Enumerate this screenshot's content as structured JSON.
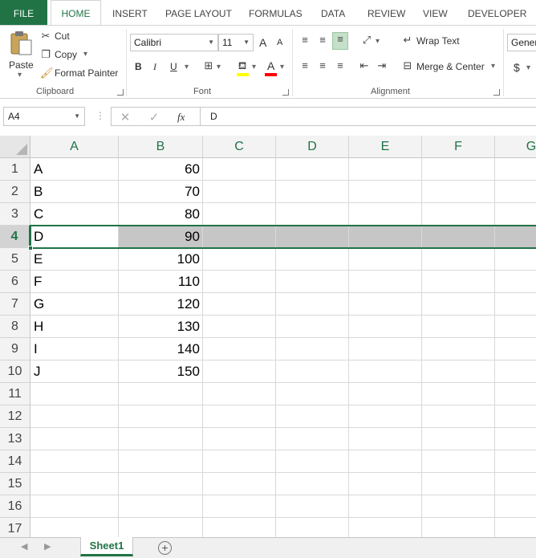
{
  "ribbon_tabs": [
    "FILE",
    "HOME",
    "INSERT",
    "PAGE LAYOUT",
    "FORMULAS",
    "DATA",
    "REVIEW",
    "VIEW",
    "DEVELOPER"
  ],
  "clipboard": {
    "paste": "Paste",
    "cut": "Cut",
    "copy": "Copy",
    "format_painter": "Format Painter",
    "label": "Clipboard"
  },
  "font": {
    "name": "Calibri",
    "size": "11",
    "bold": "B",
    "italic": "I",
    "underline": "U",
    "grow": "A",
    "shrink": "A",
    "color_letter": "A",
    "label": "Font",
    "fill_color": "#FFFF00",
    "text_color": "#FF0000"
  },
  "alignment": {
    "wrap_text": "Wrap Text",
    "merge_center": "Merge & Center",
    "label": "Alignment"
  },
  "number": {
    "format": "Gener",
    "currency_symbol": "$"
  },
  "formula_bar": {
    "name_box": "A4",
    "fx": "fx",
    "value": "D"
  },
  "columns": [
    "A",
    "B",
    "C",
    "D",
    "E",
    "F",
    "G"
  ],
  "rows": [
    "1",
    "2",
    "3",
    "4",
    "5",
    "6",
    "7",
    "8",
    "9",
    "10",
    "11",
    "12",
    "13",
    "14",
    "15",
    "16",
    "17"
  ],
  "cells": [
    [
      "A",
      "60"
    ],
    [
      "B",
      "70"
    ],
    [
      "C",
      "80"
    ],
    [
      "D",
      "90"
    ],
    [
      "E",
      "100"
    ],
    [
      "F",
      "110"
    ],
    [
      "G",
      "120"
    ],
    [
      "H",
      "130"
    ],
    [
      "I",
      "140"
    ],
    [
      "J",
      "150"
    ]
  ],
  "selected_row": 4,
  "sheets": [
    "Sheet1"
  ],
  "colors": {
    "accent": "#217346",
    "highlight": "#C6C6C6"
  }
}
